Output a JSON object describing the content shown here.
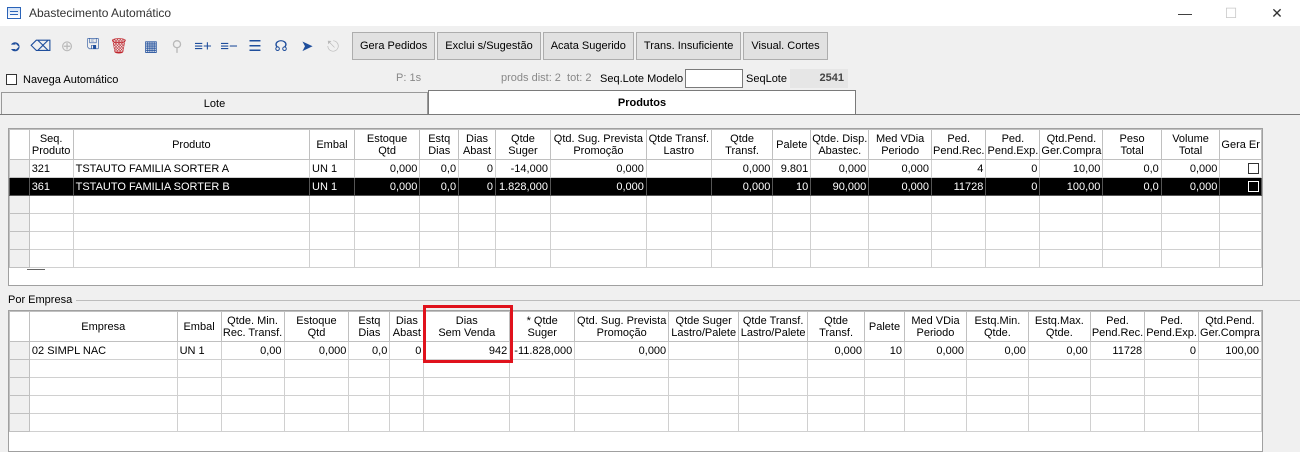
{
  "window": {
    "title": "Abastecimento Automático"
  },
  "toolbar": {
    "icons": [
      "exit-icon",
      "eraser-icon",
      "add-icon",
      "save-icon",
      "delete-icon",
      "table-icon",
      "search-icon",
      "add-list-icon",
      "remove-list-icon",
      "filter-icon",
      "binoculars-icon",
      "send-icon",
      "export-icon"
    ],
    "buttons": [
      "Gera Pedidos",
      "Exclui s/Sugestão",
      "Acata Sugerido",
      "Trans. Insuficiente",
      "Visual. Cortes"
    ]
  },
  "options": {
    "navega_label": "Navega Automático",
    "p_label": "P: 1s",
    "prods_dist": "prods dist: 2  tot: 2",
    "seq_lote_modelo_label": "Seq.Lote Modelo",
    "seq_lote_modelo_value": "",
    "seq_lote_label": "SeqLote",
    "seq_lote_value": "2541"
  },
  "tabs": {
    "lote": "Lote",
    "produtos": "Produtos"
  },
  "produtos_grid": {
    "headers": [
      "Seq.\nProduto",
      "Produto",
      "Embal",
      "Estoque\nQtd",
      "Estq\nDias",
      "Dias\nAbast",
      "Qtde\nSuger",
      "Qtd. Sug. Prevista\nPromoção",
      "Qtde Transf.\nLastro",
      "Qtde\nTransf.",
      "Palete",
      "Qtde. Disp.\nAbastec.",
      "Med VDia\nPeriodo",
      "Ped.\nPend.Rec.",
      "Ped.\nPend.Exp.",
      "Qtd.Pend.\nGer.Compra",
      "Peso\nTotal",
      "Volume\nTotal",
      "Gera Er"
    ],
    "rows": [
      [
        "321",
        "TSTAUTO FAMILIA SORTER A",
        "UN 1",
        "0,000",
        "0,0",
        "0",
        "-14,000",
        "0,000",
        "",
        "0,000",
        "9.801",
        "0,000",
        "0,000",
        "4",
        "0",
        "10,00",
        "0,0",
        "0,000"
      ],
      [
        "361",
        "TSTAUTO FAMILIA SORTER B",
        "UN 1",
        "0,000",
        "0,0",
        "0",
        "1.828,000",
        "0,000",
        "",
        "0,000",
        "10",
        "90,000",
        "0,000",
        "11728",
        "0",
        "100,00",
        "0,0",
        "0,000"
      ]
    ],
    "footer_mark": "—"
  },
  "empresa_label": "Por Empresa",
  "empresa_grid": {
    "headers": [
      "Empresa",
      "Embal",
      "Qtde. Min.\nRec. Transf.",
      "Estoque\nQtd",
      "Estq\nDias",
      "Dias\nAbast",
      "Dias\nSem Venda",
      "* Qtde\nSuger",
      "Qtd. Sug. Prevista\nPromoção",
      "Qtde Suger\nLastro/Palete",
      "Qtde Transf.\nLastro/Palete",
      "Qtde\nTransf.",
      "Palete",
      "Med VDia\nPeriodo",
      "Estq.Min.\nQtde.",
      "Estq.Max.\nQtde.",
      "Ped.\nPend.Rec.",
      "Ped.\nPend.Exp.",
      "Qtd.Pend.\nGer.Compra"
    ],
    "rows": [
      [
        "02 SIMPL NAC",
        "UN 1",
        "0,00",
        "0,000",
        "0,0",
        "0",
        "942",
        "-11.828,000",
        "0,000",
        "",
        "",
        "0,000",
        "10",
        "0,000",
        "0,00",
        "0,00",
        "11728",
        "0",
        "100,00"
      ]
    ]
  },
  "colors": {
    "highlight": "#e0121c",
    "selected_row": "#000000"
  }
}
